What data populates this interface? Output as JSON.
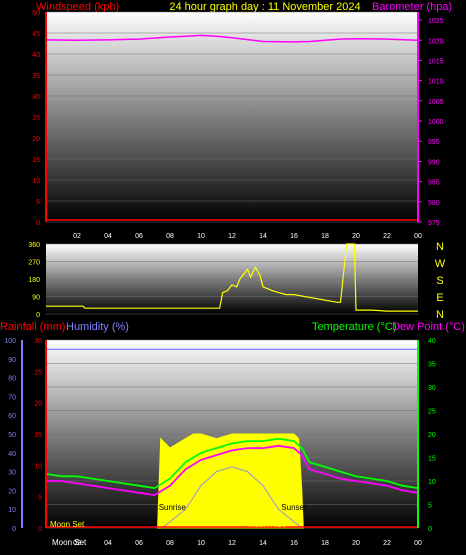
{
  "title": "24 hour graph day : 11 November 2024",
  "colors": {
    "wind": "#ff0000",
    "baro": "#ff00ff",
    "dir": "#ffff00",
    "rain": "#ff0000",
    "humidity": "#8080ff",
    "temp": "#00ff00",
    "dew": "#ff00ff",
    "solar": "#ffff00",
    "uv": "#aaaaaa",
    "ticks": "#ffffff"
  },
  "chart_data": [
    {
      "type": "line",
      "ylabel": "Windspeed (kph)",
      "ylabel2": "Barometer (hpa)",
      "x_ticks": [
        "02",
        "04",
        "06",
        "08",
        "10",
        "12",
        "14",
        "16",
        "18",
        "20",
        "22",
        "00"
      ],
      "y_ticks": [
        0,
        5,
        10,
        15,
        20,
        25,
        30,
        35,
        40,
        45,
        50
      ],
      "y2_ticks": [
        975,
        980,
        985,
        990,
        995,
        1000,
        1005,
        1010,
        1015,
        1020,
        1025
      ],
      "ylim": [
        0,
        50
      ],
      "y2lim": [
        975,
        1027
      ],
      "series": [
        {
          "name": "Windspeed (kph)",
          "axis": "y",
          "x": [
            0,
            6,
            12,
            18,
            24
          ],
          "y": [
            0.5,
            0.5,
            0.5,
            0.5,
            0.5
          ]
        },
        {
          "name": "Barometer (hpa)",
          "axis": "y2",
          "x": [
            0,
            2,
            4,
            6,
            8,
            9,
            10,
            11,
            12,
            14,
            16,
            17,
            18,
            19,
            20,
            22,
            24
          ],
          "y": [
            1020.1,
            1020.0,
            1020.1,
            1020.3,
            1020.8,
            1021.0,
            1021.2,
            1021.0,
            1020.6,
            1019.7,
            1019.6,
            1019.7,
            1020.0,
            1020.3,
            1020.4,
            1020.3,
            1020.0
          ]
        }
      ]
    },
    {
      "type": "line",
      "y_ticks": [
        0,
        90,
        180,
        270,
        360
      ],
      "compass": [
        "N",
        "W",
        "S",
        "E",
        "N"
      ],
      "ylim": [
        0,
        360
      ],
      "series": [
        {
          "name": "Wind direction",
          "x": [
            0,
            2.4,
            2.5,
            11.2,
            11.4,
            11.7,
            12.0,
            12.3,
            12.5,
            12.8,
            13.0,
            13.2,
            13.5,
            13.8,
            14.0,
            14.3,
            14.6,
            15.0,
            15.5,
            16.0,
            18.8,
            19.0,
            19.4,
            19.6,
            19.9,
            20.0,
            21.0,
            22.0,
            23.0,
            24.0
          ],
          "y": [
            40,
            40,
            30,
            30,
            110,
            120,
            150,
            140,
            180,
            210,
            230,
            190,
            240,
            200,
            140,
            130,
            120,
            110,
            100,
            100,
            60,
            60,
            360,
            360,
            360,
            20,
            20,
            15,
            15,
            15
          ]
        }
      ]
    },
    {
      "type": "line",
      "ylabel": "Rainfall (mm)",
      "ylabel_humidity": "Humidity (%)",
      "ylabel2": "Temperature (°C)",
      "ylabel3": "Dew Point (°C)",
      "x_ticks": [
        "02",
        "04",
        "06",
        "08",
        "10",
        "12",
        "14",
        "16",
        "18",
        "20",
        "22",
        "00"
      ],
      "humidity_ticks": [
        0,
        10,
        20,
        30,
        40,
        50,
        60,
        70,
        80,
        90,
        100
      ],
      "rain_ticks": [
        0,
        5,
        10,
        15,
        20,
        25,
        30
      ],
      "y2_ticks": [
        0,
        5,
        10,
        15,
        20,
        25,
        30,
        35,
        40
      ],
      "humidity_lim": [
        0,
        100
      ],
      "rain_lim": [
        0,
        30
      ],
      "y2lim": [
        0,
        40
      ],
      "labels": {
        "sunrise": "Sunrise",
        "sunset": "Sunset",
        "moonset": "Moon Set",
        "moonrise": "Moon Rise"
      },
      "sunrise_hour": 7.4,
      "sunset_hour": 16.6,
      "series": [
        {
          "name": "Rainfall (mm)",
          "axis": "rain",
          "x": [
            0,
            24
          ],
          "y": [
            0,
            0
          ]
        },
        {
          "name": "Humidity (%)",
          "axis": "humidity",
          "x": [
            0,
            24
          ],
          "y": [
            95,
            95
          ]
        },
        {
          "name": "Temperature (°C)",
          "axis": "y2",
          "x": [
            0,
            1,
            2,
            3,
            4,
            5,
            6,
            7,
            8,
            9,
            10,
            11,
            12,
            13,
            14,
            15,
            16,
            16.5,
            17,
            18,
            19,
            20,
            21,
            22,
            23,
            24
          ],
          "y": [
            11.5,
            11,
            11,
            10.5,
            10,
            9.5,
            9,
            8.5,
            10.5,
            14,
            16,
            17,
            18,
            18.5,
            18.5,
            19,
            18.5,
            17,
            14,
            13,
            12,
            11,
            10.5,
            10,
            9,
            8.5
          ]
        },
        {
          "name": "Dew Point (°C)",
          "axis": "y2",
          "x": [
            0,
            1,
            2,
            3,
            4,
            5,
            6,
            7,
            8,
            9,
            10,
            11,
            12,
            13,
            14,
            15,
            16,
            16.5,
            17,
            18,
            19,
            20,
            21,
            22,
            23,
            24
          ],
          "y": [
            10,
            10,
            9.5,
            9,
            8.5,
            8,
            7.5,
            7,
            9,
            12.5,
            14.5,
            15.5,
            16.5,
            17,
            17,
            17.5,
            17,
            15.5,
            12.5,
            11.5,
            10.5,
            10,
            9.5,
            9,
            8,
            7.5
          ]
        },
        {
          "name": "Solar radiation",
          "axis": "y2",
          "x": [
            7.2,
            7.4,
            8.0,
            9.0,
            9.5,
            10.0,
            11.0,
            12.0,
            13.0,
            14.0,
            15.0,
            16.0,
            16.3,
            16.5,
            16.6
          ],
          "y": [
            0,
            19,
            17,
            19,
            20,
            20,
            19,
            20,
            20,
            20,
            20,
            20,
            19,
            8,
            0
          ]
        },
        {
          "name": "UV",
          "axis": "y2",
          "x": [
            7.5,
            9,
            10,
            11,
            12,
            13,
            14,
            15,
            16.5
          ],
          "y": [
            0,
            4,
            9,
            12,
            13,
            12,
            9,
            4,
            0
          ]
        }
      ]
    }
  ]
}
